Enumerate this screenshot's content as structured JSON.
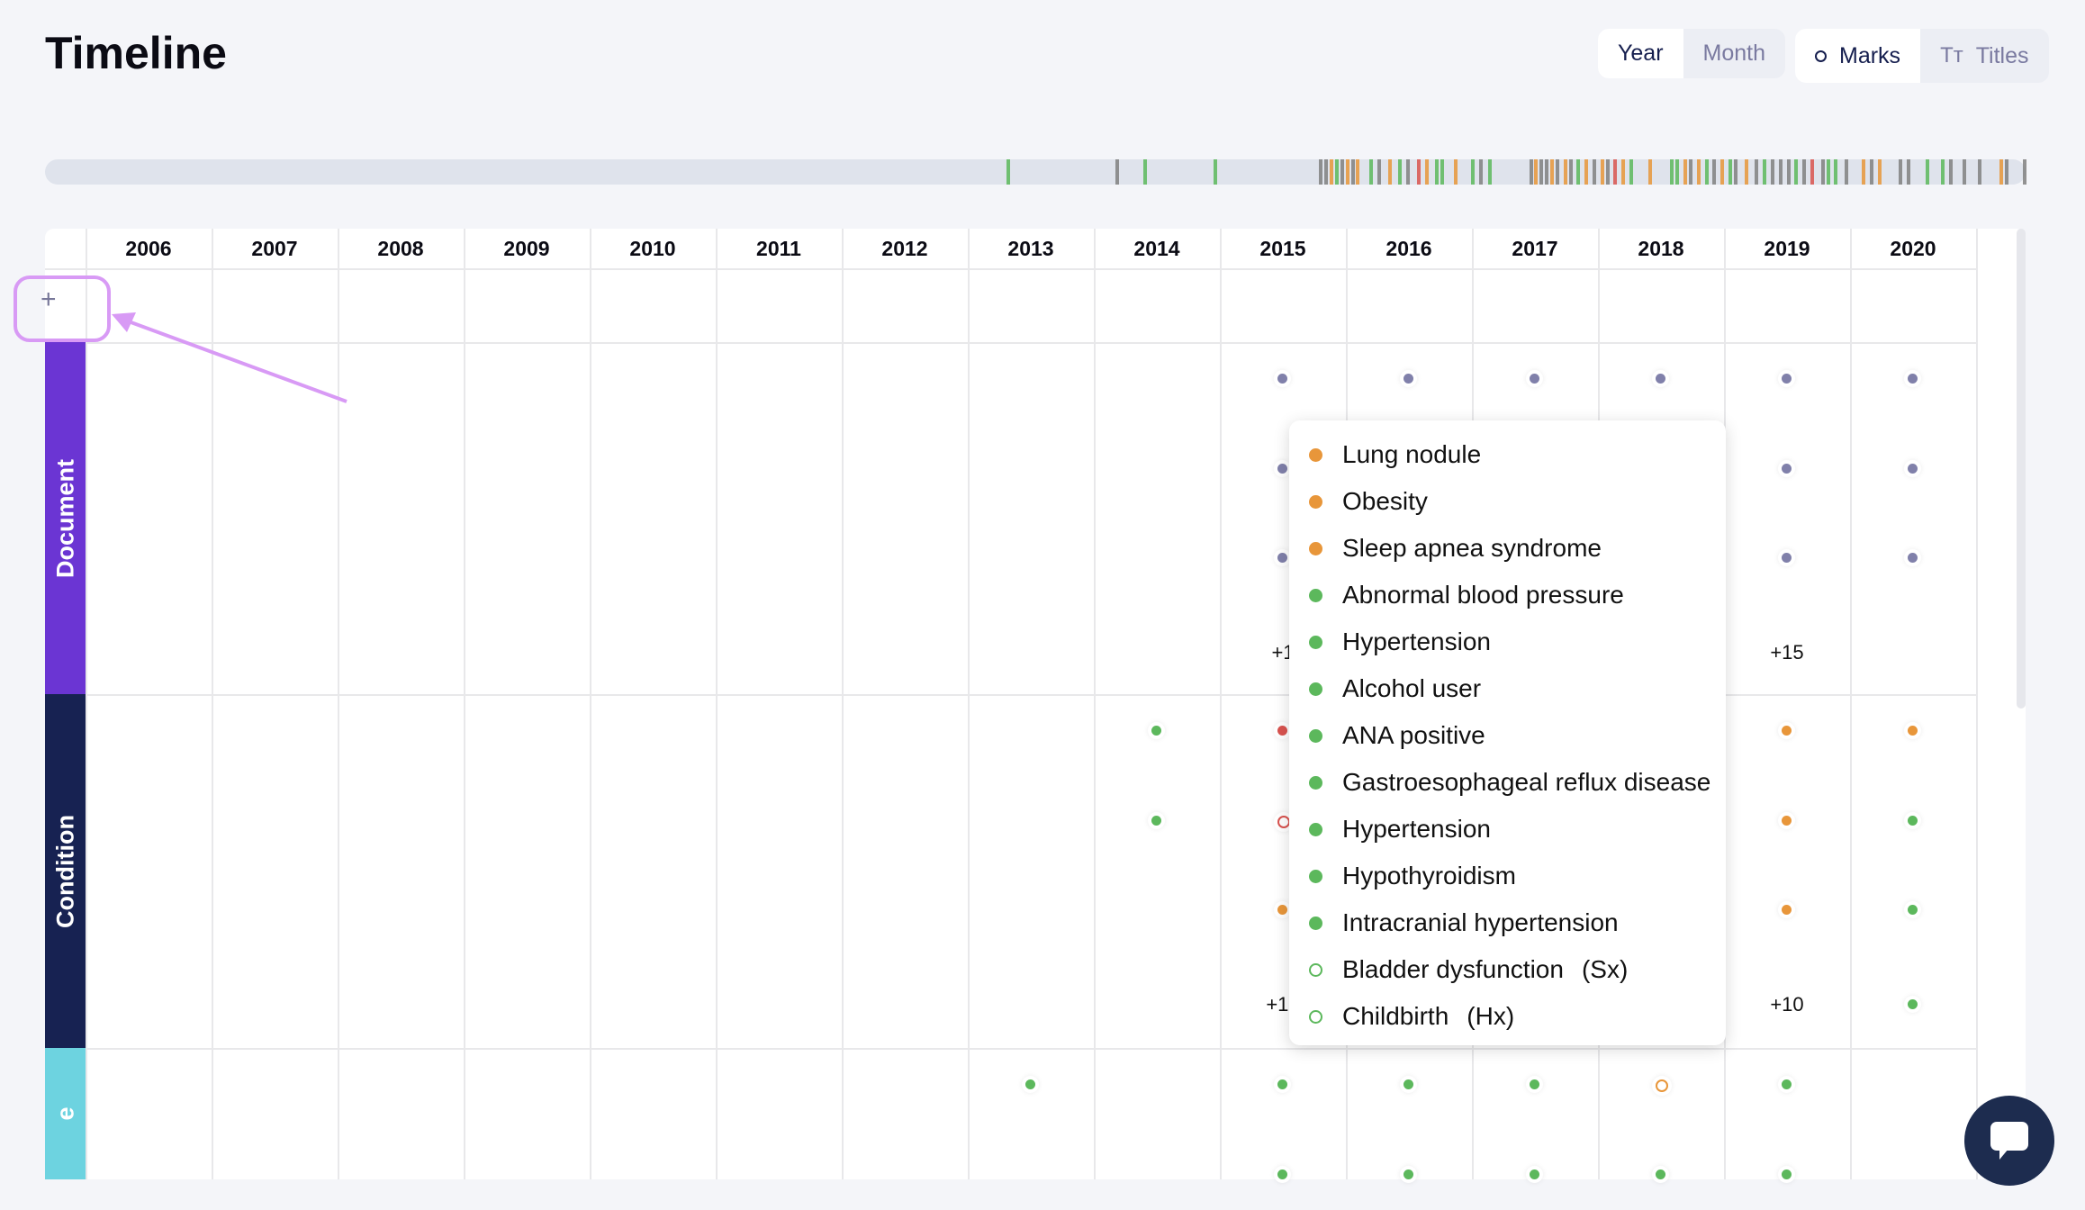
{
  "header": {
    "title": "Timeline"
  },
  "scale_toggle": {
    "options": [
      "Year",
      "Month"
    ],
    "selected": "Year"
  },
  "view_toggle": {
    "marks_label": "Marks",
    "titles_label": "Titles",
    "selected": "Marks",
    "marks_icon": "circle-icon",
    "titles_icon": "text-size-icon",
    "titles_glyph": "Tт"
  },
  "add_button": {
    "label": "+"
  },
  "colors": {
    "document": "#6b35d3",
    "condition": "#172252",
    "third": "#6dd3e0",
    "purple": "#8080aa",
    "green": "#5cb85c",
    "orange": "#e8963a",
    "red": "#d9534f",
    "gray": "#808080"
  },
  "overview": {
    "range": [
      2006,
      2021
    ],
    "ticks": [
      [
        2013.28,
        "green"
      ],
      [
        2014.11,
        "gray"
      ],
      [
        2014.32,
        "green"
      ],
      [
        2014.85,
        "green"
      ],
      [
        2015.65,
        "gray"
      ],
      [
        2015.69,
        "gray"
      ],
      [
        2015.73,
        "orange"
      ],
      [
        2015.77,
        "green"
      ],
      [
        2015.81,
        "gray"
      ],
      [
        2015.85,
        "orange"
      ],
      [
        2015.89,
        "gray"
      ],
      [
        2015.93,
        "orange"
      ],
      [
        2016.03,
        "green"
      ],
      [
        2016.09,
        "gray"
      ],
      [
        2016.17,
        "orange"
      ],
      [
        2016.25,
        "green"
      ],
      [
        2016.31,
        "gray"
      ],
      [
        2016.39,
        "red"
      ],
      [
        2016.45,
        "orange"
      ],
      [
        2016.53,
        "green"
      ],
      [
        2016.57,
        "green"
      ],
      [
        2016.67,
        "orange"
      ],
      [
        2016.8,
        "green"
      ],
      [
        2016.86,
        "gray"
      ],
      [
        2016.93,
        "green"
      ],
      [
        2017.24,
        "gray"
      ],
      [
        2017.28,
        "orange"
      ],
      [
        2017.32,
        "gray"
      ],
      [
        2017.36,
        "gray"
      ],
      [
        2017.4,
        "orange"
      ],
      [
        2017.44,
        "gray"
      ],
      [
        2017.5,
        "orange"
      ],
      [
        2017.54,
        "gray"
      ],
      [
        2017.6,
        "green"
      ],
      [
        2017.66,
        "orange"
      ],
      [
        2017.72,
        "gray"
      ],
      [
        2017.78,
        "orange"
      ],
      [
        2017.82,
        "gray"
      ],
      [
        2017.88,
        "red"
      ],
      [
        2017.94,
        "orange"
      ],
      [
        2018.0,
        "green"
      ],
      [
        2018.14,
        "orange"
      ],
      [
        2018.31,
        "green"
      ],
      [
        2018.35,
        "green"
      ],
      [
        2018.41,
        "orange"
      ],
      [
        2018.45,
        "gray"
      ],
      [
        2018.51,
        "orange"
      ],
      [
        2018.57,
        "green"
      ],
      [
        2018.63,
        "gray"
      ],
      [
        2018.69,
        "orange"
      ],
      [
        2018.75,
        "green"
      ],
      [
        2018.79,
        "gray"
      ],
      [
        2018.87,
        "orange"
      ],
      [
        2018.95,
        "gray"
      ],
      [
        2019.01,
        "green"
      ],
      [
        2019.07,
        "gray"
      ],
      [
        2019.13,
        "gray"
      ],
      [
        2019.19,
        "gray"
      ],
      [
        2019.25,
        "green"
      ],
      [
        2019.31,
        "gray"
      ],
      [
        2019.37,
        "red"
      ],
      [
        2019.45,
        "gray"
      ],
      [
        2019.49,
        "green"
      ],
      [
        2019.55,
        "green"
      ],
      [
        2019.63,
        "gray"
      ],
      [
        2019.76,
        "orange"
      ],
      [
        2019.82,
        "gray"
      ],
      [
        2019.88,
        "orange"
      ],
      [
        2020.04,
        "gray"
      ],
      [
        2020.1,
        "gray"
      ],
      [
        2020.24,
        "green"
      ],
      [
        2020.36,
        "green"
      ],
      [
        2020.42,
        "gray"
      ],
      [
        2020.52,
        "gray"
      ],
      [
        2020.64,
        "gray"
      ],
      [
        2020.8,
        "orange"
      ],
      [
        2020.84,
        "gray"
      ],
      [
        2020.98,
        "gray"
      ]
    ]
  },
  "years": [
    "2006",
    "2007",
    "2008",
    "2009",
    "2010",
    "2011",
    "2012",
    "2013",
    "2014",
    "2015",
    "2016",
    "2017",
    "2018",
    "2019",
    "2020"
  ],
  "rows": [
    {
      "label": "Document",
      "color": "#6b35d3",
      "dots": [
        {
          "year": "2015",
          "slot": 0,
          "c": "purple"
        },
        {
          "year": "2016",
          "slot": 0,
          "c": "purple"
        },
        {
          "year": "2017",
          "slot": 0,
          "c": "purple"
        },
        {
          "year": "2018",
          "slot": 0,
          "c": "purple"
        },
        {
          "year": "2019",
          "slot": 0,
          "c": "purple"
        },
        {
          "year": "2020",
          "slot": 0,
          "c": "purple"
        },
        {
          "year": "2015",
          "slot": 1,
          "c": "purple"
        },
        {
          "year": "2019",
          "slot": 1,
          "c": "purple"
        },
        {
          "year": "2020",
          "slot": 1,
          "c": "purple"
        },
        {
          "year": "2015",
          "slot": 2,
          "c": "purple"
        },
        {
          "year": "2019",
          "slot": 2,
          "c": "purple"
        },
        {
          "year": "2020",
          "slot": 2,
          "c": "purple"
        }
      ],
      "more": [
        {
          "year": "2015",
          "text": "+1"
        },
        {
          "year": "2019",
          "text": "+15"
        }
      ]
    },
    {
      "label": "Condition",
      "color": "#172252",
      "dots": [
        {
          "year": "2014",
          "slot": 0,
          "c": "green"
        },
        {
          "year": "2014",
          "slot": 1,
          "c": "green"
        },
        {
          "year": "2015",
          "slot": 0,
          "c": "red"
        },
        {
          "year": "2015",
          "slot": 1,
          "c": "red",
          "hollow": true
        },
        {
          "year": "2015",
          "slot": 2,
          "c": "orange"
        },
        {
          "year": "2019",
          "slot": 0,
          "c": "orange"
        },
        {
          "year": "2019",
          "slot": 1,
          "c": "orange"
        },
        {
          "year": "2019",
          "slot": 2,
          "c": "orange"
        },
        {
          "year": "2020",
          "slot": 0,
          "c": "orange"
        },
        {
          "year": "2020",
          "slot": 1,
          "c": "green"
        },
        {
          "year": "2020",
          "slot": 2,
          "c": "green"
        },
        {
          "year": "2020",
          "slot": 3,
          "c": "green"
        }
      ],
      "more": [
        {
          "year": "2015",
          "text": "+10"
        },
        {
          "year": "2019",
          "text": "+10"
        }
      ]
    },
    {
      "label": "e",
      "color": "#6dd3e0",
      "dots": [
        {
          "year": "2013",
          "slot": 0,
          "c": "green"
        },
        {
          "year": "2015",
          "slot": 0,
          "c": "green"
        },
        {
          "year": "2016",
          "slot": 0,
          "c": "green"
        },
        {
          "year": "2017",
          "slot": 0,
          "c": "green"
        },
        {
          "year": "2018",
          "slot": 0,
          "c": "orange",
          "hollow": true
        },
        {
          "year": "2019",
          "slot": 0,
          "c": "green"
        },
        {
          "year": "2015",
          "slot": 1,
          "c": "green"
        },
        {
          "year": "2016",
          "slot": 1,
          "c": "green"
        },
        {
          "year": "2017",
          "slot": 1,
          "c": "green"
        },
        {
          "year": "2018",
          "slot": 1,
          "c": "green"
        },
        {
          "year": "2019",
          "slot": 1,
          "c": "green"
        }
      ],
      "more": []
    }
  ],
  "popover": {
    "items": [
      {
        "label": "Lung nodule",
        "c": "orange"
      },
      {
        "label": "Obesity",
        "c": "orange"
      },
      {
        "label": "Sleep apnea syndrome",
        "c": "orange"
      },
      {
        "label": "Abnormal blood pressure",
        "c": "green"
      },
      {
        "label": "Hypertension",
        "c": "green"
      },
      {
        "label": "Alcohol user",
        "c": "green"
      },
      {
        "label": "ANA positive",
        "c": "green"
      },
      {
        "label": "Gastroesophageal reflux disease",
        "c": "green"
      },
      {
        "label": "Hypertension",
        "c": "green"
      },
      {
        "label": "Hypothyroidism",
        "c": "green"
      },
      {
        "label": "Intracranial hypertension",
        "c": "green"
      },
      {
        "label": "Bladder dysfunction",
        "c": "green",
        "hollow": true,
        "suffix": "(Sx)"
      },
      {
        "label": "Childbirth",
        "c": "green",
        "hollow": true,
        "suffix": "(Hx)"
      }
    ]
  },
  "chat": {
    "icon": "chat-bubble-icon"
  },
  "annotation": {
    "color": "#d89af5"
  }
}
